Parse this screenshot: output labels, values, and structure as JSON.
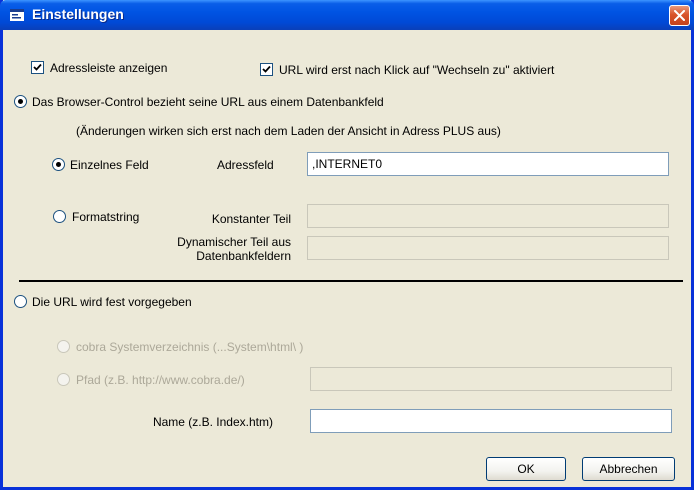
{
  "window": {
    "title": "Einstellungen"
  },
  "checkboxes": {
    "adressleiste": {
      "label": "Adressleiste anzeigen",
      "checked": true
    },
    "url_klick": {
      "label": "URL wird erst nach Klick auf \"Wechseln zu\" aktiviert",
      "checked": true
    }
  },
  "datenbankfeld": {
    "label": "Das Browser-Control bezieht seine URL aus einem Datenbankfeld",
    "selected": true,
    "note": "(Änderungen wirken sich erst nach dem Laden der Ansicht in Adress PLUS aus)",
    "einzelnes_feld": {
      "label": "Einzelnes Feld",
      "selected": true
    },
    "adressfeld": {
      "label": "Adressfeld",
      "value": ",INTERNET0"
    },
    "formatstring": {
      "label": "Formatstring",
      "selected": false
    },
    "konstanter_teil": {
      "label": "Konstanter Teil",
      "value": ""
    },
    "dynamischer_teil": {
      "label_line1": "Dynamischer Teil aus",
      "label_line2": "Datenbankfeldern",
      "value": ""
    }
  },
  "fest": {
    "label": "Die URL wird fest vorgegeben",
    "selected": false,
    "systemverzeichnis": {
      "label": "cobra Systemverzeichnis (...System\\html\\ )"
    },
    "pfad": {
      "label": "Pfad (z.B. http://www.cobra.de/)",
      "value": ""
    },
    "name": {
      "label": "Name (z.B. Index.htm)",
      "value": ""
    }
  },
  "buttons": {
    "ok": "OK",
    "cancel": "Abbrechen"
  },
  "colors": {
    "title_bar": "#0054e3",
    "dialog_bg": "#ece9d8",
    "close_button": "#d9542a"
  }
}
